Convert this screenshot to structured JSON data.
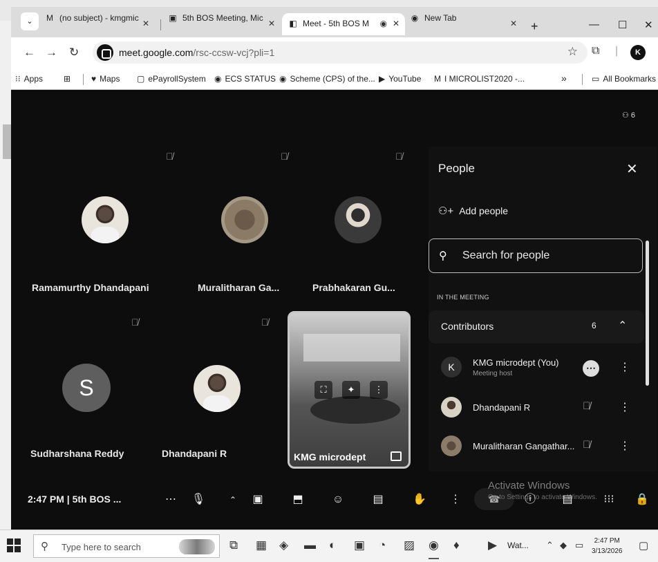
{
  "browser": {
    "tabs": [
      {
        "favicon": "gmail-icon",
        "title": "(no subject) - kmgmic",
        "active": false
      },
      {
        "favicon": "calendar-icon",
        "title": "5th BOS Meeting, Mic",
        "active": false
      },
      {
        "favicon": "meet-icon",
        "title": "Meet - 5th BOS M",
        "active": true
      },
      {
        "favicon": "chrome-icon",
        "title": "New Tab",
        "active": false
      }
    ],
    "new_tab": "+",
    "url_domain": "meet.google.com",
    "url_path": "/rsc-ccsw-vcj?pli=1",
    "profile_initial": "K",
    "bookmarks": [
      {
        "icon": "apps-grid-icon",
        "label": "Apps"
      },
      {
        "icon": "maps-pin-icon",
        "label": "Maps"
      },
      {
        "icon": "epayroll-icon",
        "label": "ePayrollSystem"
      },
      {
        "icon": "globe-icon",
        "label": "ECS STATUS"
      },
      {
        "icon": "globe-icon",
        "label": "Scheme (CPS) of the..."
      },
      {
        "icon": "youtube-icon",
        "label": "YouTube"
      },
      {
        "icon": "gmail-icon",
        "label": "I MICROLIST2020 -..."
      }
    ],
    "bookmarks_overflow": "»",
    "all_bookmarks": "All Bookmarks"
  },
  "meet": {
    "participant_count_badge": "6",
    "tiles": [
      {
        "name": "Ramamurthy Dhandapani",
        "muted": true
      },
      {
        "name": "Muralitharan Ga...",
        "muted": true
      },
      {
        "name": "Prabhakaran Gu...",
        "muted": true
      },
      {
        "name": "Sudharshana Reddy",
        "muted": true,
        "initial": "S"
      },
      {
        "name": "Dhandapani R",
        "muted": true
      },
      {
        "name": "KMG microdept",
        "self": true
      }
    ],
    "people_panel": {
      "title": "People",
      "add_people": "Add people",
      "search_placeholder": "Search for people",
      "section_label": "IN THE MEETING",
      "contributors_label": "Contributors",
      "contributors_count": "6",
      "people": [
        {
          "initial": "K",
          "name": "KMG microdept (You)",
          "role": "Meeting host",
          "status": "more-options-icon"
        },
        {
          "name": "Dhandapani R",
          "status": "mic-off-icon"
        },
        {
          "name": "Muralitharan Gangathar...",
          "status": "mic-off-icon"
        }
      ]
    },
    "bottom_bar": {
      "time_meeting": "2:47 PM | 5th BOS ...",
      "activate_title": "Activate Windows",
      "activate_sub": "Go to Settings to activate Windows."
    }
  },
  "taskbar": {
    "search_placeholder": "Type here to search",
    "app_label": "Wat...",
    "time": "2:47 PM",
    "date": "3/13/2026"
  }
}
